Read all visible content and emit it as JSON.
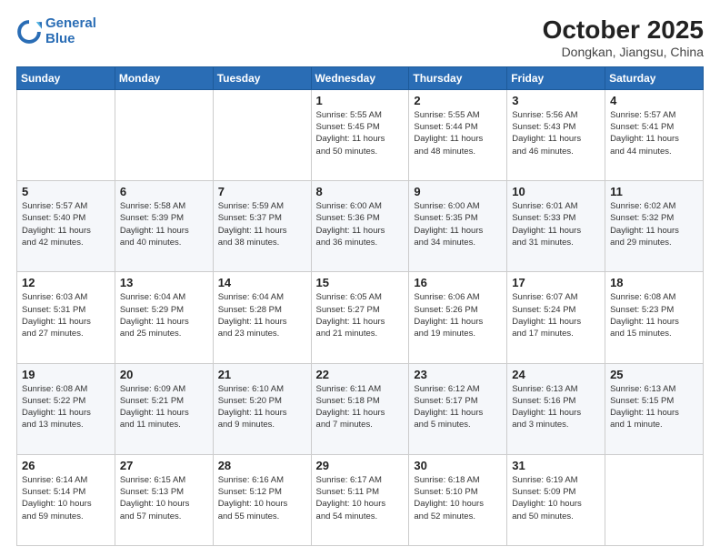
{
  "logo": {
    "line1": "General",
    "line2": "Blue"
  },
  "title": "October 2025",
  "subtitle": "Dongkan, Jiangsu, China",
  "days_header": [
    "Sunday",
    "Monday",
    "Tuesday",
    "Wednesday",
    "Thursday",
    "Friday",
    "Saturday"
  ],
  "weeks": [
    [
      {
        "num": "",
        "info": ""
      },
      {
        "num": "",
        "info": ""
      },
      {
        "num": "",
        "info": ""
      },
      {
        "num": "1",
        "info": "Sunrise: 5:55 AM\nSunset: 5:45 PM\nDaylight: 11 hours\nand 50 minutes."
      },
      {
        "num": "2",
        "info": "Sunrise: 5:55 AM\nSunset: 5:44 PM\nDaylight: 11 hours\nand 48 minutes."
      },
      {
        "num": "3",
        "info": "Sunrise: 5:56 AM\nSunset: 5:43 PM\nDaylight: 11 hours\nand 46 minutes."
      },
      {
        "num": "4",
        "info": "Sunrise: 5:57 AM\nSunset: 5:41 PM\nDaylight: 11 hours\nand 44 minutes."
      }
    ],
    [
      {
        "num": "5",
        "info": "Sunrise: 5:57 AM\nSunset: 5:40 PM\nDaylight: 11 hours\nand 42 minutes."
      },
      {
        "num": "6",
        "info": "Sunrise: 5:58 AM\nSunset: 5:39 PM\nDaylight: 11 hours\nand 40 minutes."
      },
      {
        "num": "7",
        "info": "Sunrise: 5:59 AM\nSunset: 5:37 PM\nDaylight: 11 hours\nand 38 minutes."
      },
      {
        "num": "8",
        "info": "Sunrise: 6:00 AM\nSunset: 5:36 PM\nDaylight: 11 hours\nand 36 minutes."
      },
      {
        "num": "9",
        "info": "Sunrise: 6:00 AM\nSunset: 5:35 PM\nDaylight: 11 hours\nand 34 minutes."
      },
      {
        "num": "10",
        "info": "Sunrise: 6:01 AM\nSunset: 5:33 PM\nDaylight: 11 hours\nand 31 minutes."
      },
      {
        "num": "11",
        "info": "Sunrise: 6:02 AM\nSunset: 5:32 PM\nDaylight: 11 hours\nand 29 minutes."
      }
    ],
    [
      {
        "num": "12",
        "info": "Sunrise: 6:03 AM\nSunset: 5:31 PM\nDaylight: 11 hours\nand 27 minutes."
      },
      {
        "num": "13",
        "info": "Sunrise: 6:04 AM\nSunset: 5:29 PM\nDaylight: 11 hours\nand 25 minutes."
      },
      {
        "num": "14",
        "info": "Sunrise: 6:04 AM\nSunset: 5:28 PM\nDaylight: 11 hours\nand 23 minutes."
      },
      {
        "num": "15",
        "info": "Sunrise: 6:05 AM\nSunset: 5:27 PM\nDaylight: 11 hours\nand 21 minutes."
      },
      {
        "num": "16",
        "info": "Sunrise: 6:06 AM\nSunset: 5:26 PM\nDaylight: 11 hours\nand 19 minutes."
      },
      {
        "num": "17",
        "info": "Sunrise: 6:07 AM\nSunset: 5:24 PM\nDaylight: 11 hours\nand 17 minutes."
      },
      {
        "num": "18",
        "info": "Sunrise: 6:08 AM\nSunset: 5:23 PM\nDaylight: 11 hours\nand 15 minutes."
      }
    ],
    [
      {
        "num": "19",
        "info": "Sunrise: 6:08 AM\nSunset: 5:22 PM\nDaylight: 11 hours\nand 13 minutes."
      },
      {
        "num": "20",
        "info": "Sunrise: 6:09 AM\nSunset: 5:21 PM\nDaylight: 11 hours\nand 11 minutes."
      },
      {
        "num": "21",
        "info": "Sunrise: 6:10 AM\nSunset: 5:20 PM\nDaylight: 11 hours\nand 9 minutes."
      },
      {
        "num": "22",
        "info": "Sunrise: 6:11 AM\nSunset: 5:18 PM\nDaylight: 11 hours\nand 7 minutes."
      },
      {
        "num": "23",
        "info": "Sunrise: 6:12 AM\nSunset: 5:17 PM\nDaylight: 11 hours\nand 5 minutes."
      },
      {
        "num": "24",
        "info": "Sunrise: 6:13 AM\nSunset: 5:16 PM\nDaylight: 11 hours\nand 3 minutes."
      },
      {
        "num": "25",
        "info": "Sunrise: 6:13 AM\nSunset: 5:15 PM\nDaylight: 11 hours\nand 1 minute."
      }
    ],
    [
      {
        "num": "26",
        "info": "Sunrise: 6:14 AM\nSunset: 5:14 PM\nDaylight: 10 hours\nand 59 minutes."
      },
      {
        "num": "27",
        "info": "Sunrise: 6:15 AM\nSunset: 5:13 PM\nDaylight: 10 hours\nand 57 minutes."
      },
      {
        "num": "28",
        "info": "Sunrise: 6:16 AM\nSunset: 5:12 PM\nDaylight: 10 hours\nand 55 minutes."
      },
      {
        "num": "29",
        "info": "Sunrise: 6:17 AM\nSunset: 5:11 PM\nDaylight: 10 hours\nand 54 minutes."
      },
      {
        "num": "30",
        "info": "Sunrise: 6:18 AM\nSunset: 5:10 PM\nDaylight: 10 hours\nand 52 minutes."
      },
      {
        "num": "31",
        "info": "Sunrise: 6:19 AM\nSunset: 5:09 PM\nDaylight: 10 hours\nand 50 minutes."
      },
      {
        "num": "",
        "info": ""
      }
    ]
  ]
}
